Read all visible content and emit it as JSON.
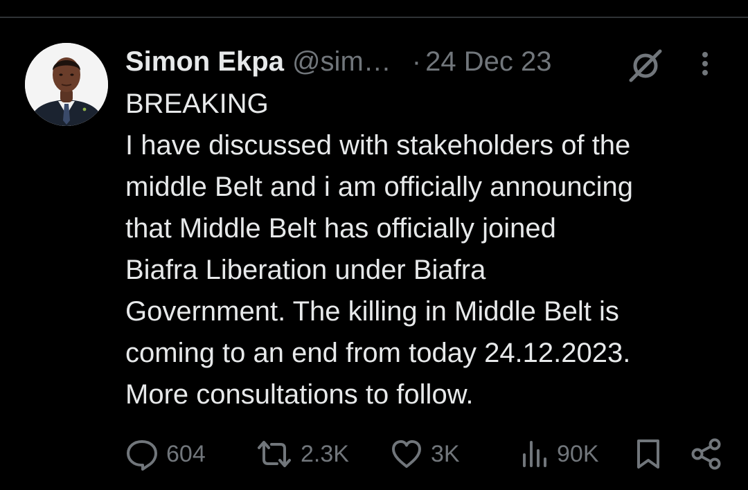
{
  "tweet": {
    "author": {
      "display_name": "Simon Ekpa",
      "handle": "@sim…"
    },
    "separator": "·",
    "date": "24 Dec 23",
    "text_lines": [
      "BREAKING",
      "I have discussed with stakeholders of the",
      "middle Belt and i am officially announcing",
      "that Middle Belt has officially joined",
      "Biafra Liberation under Biafra",
      "Government. The killing in Middle Belt is",
      "coming to an end from today 24.12.2023.",
      "More consultations to follow."
    ],
    "stats": {
      "replies": "604",
      "reposts": "2.3K",
      "likes": "3K",
      "views": "90K"
    }
  },
  "icons": {
    "grok": "grok-icon",
    "more": "more-dots-icon",
    "reply": "reply-icon",
    "repost": "repost-icon",
    "like": "heart-icon",
    "views": "views-chart-icon",
    "bookmark": "bookmark-icon",
    "share": "share-icon"
  },
  "colors": {
    "background": "#000000",
    "primary_text": "#e7e9ea",
    "secondary_text": "#71767b",
    "divider": "#2f3336"
  }
}
